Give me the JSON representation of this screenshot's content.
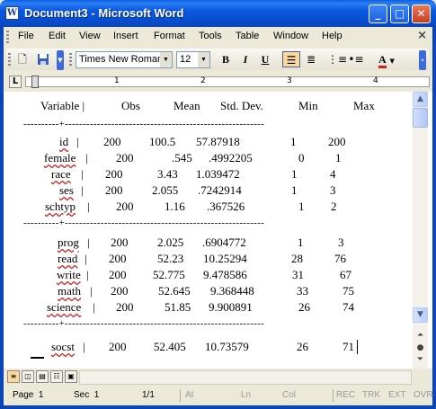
{
  "window": {
    "title": "Document3 - Microsoft Word"
  },
  "menu": {
    "items": [
      "File",
      "Edit",
      "View",
      "Insert",
      "Format",
      "Tools",
      "Table",
      "Window",
      "Help"
    ],
    "close_glyph": "×"
  },
  "toolbar": {
    "font_name": "Times New Roman",
    "font_size": "12",
    "bold": "B",
    "italic": "I",
    "underline": "U",
    "font_color_letter": "A"
  },
  "ruler": {
    "tab_selector": "L",
    "numbers": [
      "1",
      "2",
      "3",
      "4"
    ]
  },
  "table": {
    "header": [
      "Variable |",
      "Obs",
      "Mean",
      "Std. Dev.",
      "Min",
      "Max"
    ],
    "separators": [
      "----------+--------------------------------------------------------",
      "----------+--------------------------------------------------------",
      "----------+--------------------------------------------------------"
    ],
    "groups": [
      [
        [
          "id",
          "200",
          "100.5",
          "57.87918",
          "1",
          "200"
        ],
        [
          "female",
          "200",
          ".545",
          ".4992205",
          "0",
          "1"
        ],
        [
          "race",
          "200",
          "3.43",
          "1.039472",
          "1",
          "4"
        ],
        [
          "ses",
          "200",
          "2.055",
          ".7242914",
          "1",
          "3"
        ],
        [
          "schtyp",
          "200",
          "1.16",
          ".367526",
          "1",
          "2"
        ]
      ],
      [
        [
          "prog",
          "200",
          "2.025",
          ".6904772",
          "1",
          "3"
        ],
        [
          "read",
          "200",
          "52.23",
          "10.25294",
          "28",
          "76"
        ],
        [
          "write",
          "200",
          "52.775",
          "9.478586",
          "31",
          "67"
        ],
        [
          "math",
          "200",
          "52.645",
          "9.368448",
          "33",
          "75"
        ],
        [
          "science",
          "200",
          "51.85",
          "9.900891",
          "26",
          "74"
        ]
      ],
      [
        [
          "socst",
          "200",
          "52.405",
          "10.73579",
          "26",
          "71"
        ]
      ]
    ]
  },
  "status": {
    "page": "Page  1",
    "sec": "Sec  1",
    "pages": "1/1",
    "at": "At",
    "ln": "Ln",
    "col": "Col",
    "rec": "REC",
    "trk": "TRK",
    "ext": "EXT",
    "ovr": "OVR"
  },
  "colors": {
    "title_blue": "#0a58de",
    "frame_blue": "#0b46b8",
    "squiggle": "#d02020",
    "highlight": "#fcd99a"
  }
}
